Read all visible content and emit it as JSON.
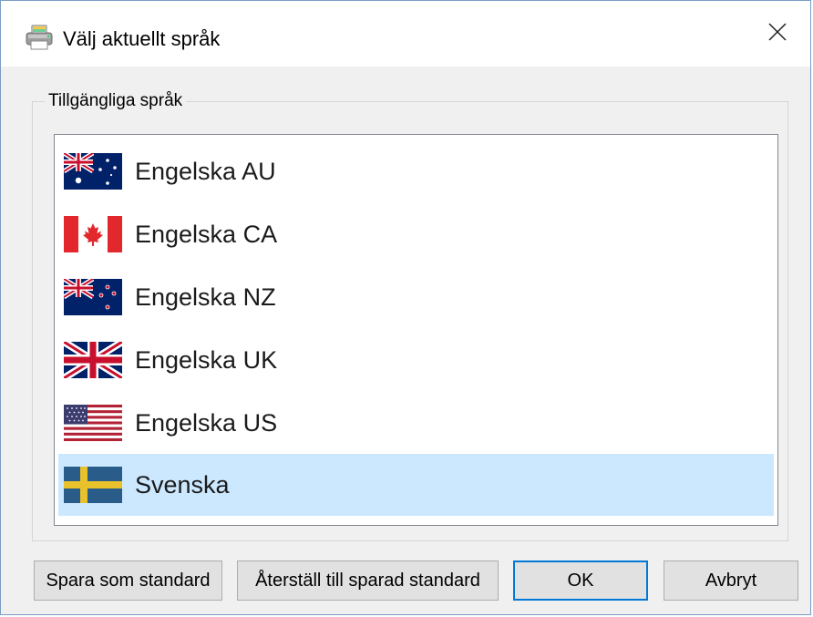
{
  "window": {
    "title": "Välj aktuellt språk",
    "app_icon": "printer-app-icon",
    "close_icon": "close-icon"
  },
  "group": {
    "legend": "Tillgängliga språk"
  },
  "languages": [
    {
      "label": "Engelska AU",
      "flag": "flag-australia-icon",
      "selected": false
    },
    {
      "label": "Engelska CA",
      "flag": "flag-canada-icon",
      "selected": false
    },
    {
      "label": "Engelska NZ",
      "flag": "flag-new-zealand-icon",
      "selected": false
    },
    {
      "label": "Engelska UK",
      "flag": "flag-united-kingdom-icon",
      "selected": false
    },
    {
      "label": "Engelska US",
      "flag": "flag-united-states-icon",
      "selected": false
    },
    {
      "label": "Svenska",
      "flag": "flag-sweden-icon",
      "selected": true
    }
  ],
  "buttons": {
    "save_default": "Spara som standard",
    "restore_default": "Återställ till sparad standard",
    "ok": "OK",
    "cancel": "Avbryt"
  },
  "colors": {
    "selection": "#cce8ff",
    "default_button_border": "#0078d7",
    "window_border": "#7a9cc6",
    "dialog_background": "#f0f0f0"
  }
}
